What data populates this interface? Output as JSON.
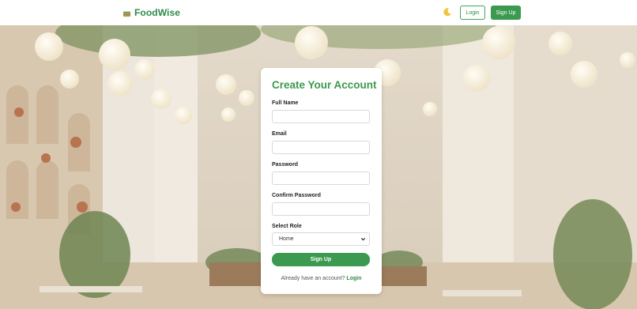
{
  "brand": {
    "name": "FoodWise",
    "icon": "cake-icon"
  },
  "nav": {
    "theme_icon": "moon-icon",
    "login_label": "Login",
    "signup_label": "Sign Up"
  },
  "form": {
    "title": "Create Your Account",
    "fields": [
      {
        "label": "Full Name",
        "value": "",
        "placeholder": ""
      },
      {
        "label": "Email",
        "value": "",
        "placeholder": ""
      },
      {
        "label": "Password",
        "value": "",
        "placeholder": ""
      },
      {
        "label": "Confirm Password",
        "value": "",
        "placeholder": ""
      }
    ],
    "role": {
      "label": "Select Role",
      "selected": "Home"
    },
    "submit_label": "Sign Up",
    "footer_text": "Already have an account?",
    "footer_link": "Login"
  },
  "colors": {
    "accent": "#3b9a4f",
    "brand_text": "#2e8b4a",
    "card_bg": "#ffffff"
  }
}
